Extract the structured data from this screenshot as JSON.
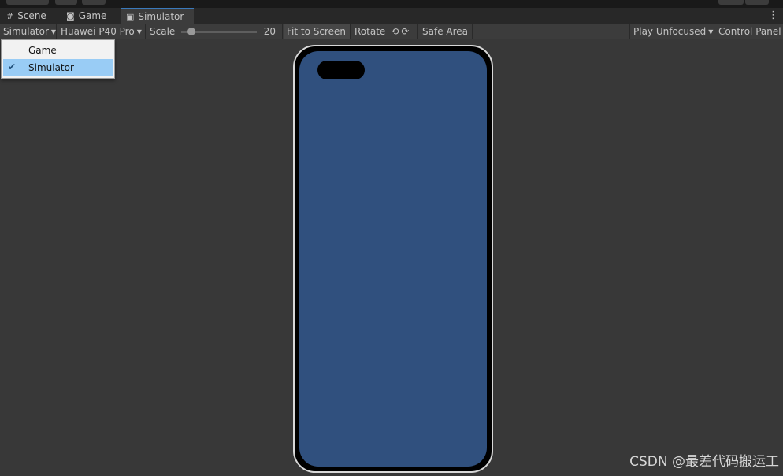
{
  "tabs": [
    {
      "icon": "#",
      "label": "Scene"
    },
    {
      "icon": "◙",
      "label": "Game"
    },
    {
      "icon": "▣",
      "label": "Simulator"
    }
  ],
  "toolbar": {
    "view_mode": "Simulator",
    "device": "Huawei P40 Pro",
    "scale_label": "Scale",
    "scale_value": "20",
    "fit_to_screen": "Fit to Screen",
    "rotate": "Rotate",
    "safe_area": "Safe Area",
    "play_focus": "Play Unfocused",
    "control_panel": "Control Panel"
  },
  "menu": {
    "items": [
      {
        "label": "Game",
        "selected": false
      },
      {
        "label": "Simulator",
        "selected": true
      }
    ]
  },
  "watermark": "CSDN @最差代码搬运工",
  "colors": {
    "background": "#383838",
    "screen": "#30507e",
    "accent": "#3a79bb",
    "menu_selected": "#99ccf5"
  }
}
